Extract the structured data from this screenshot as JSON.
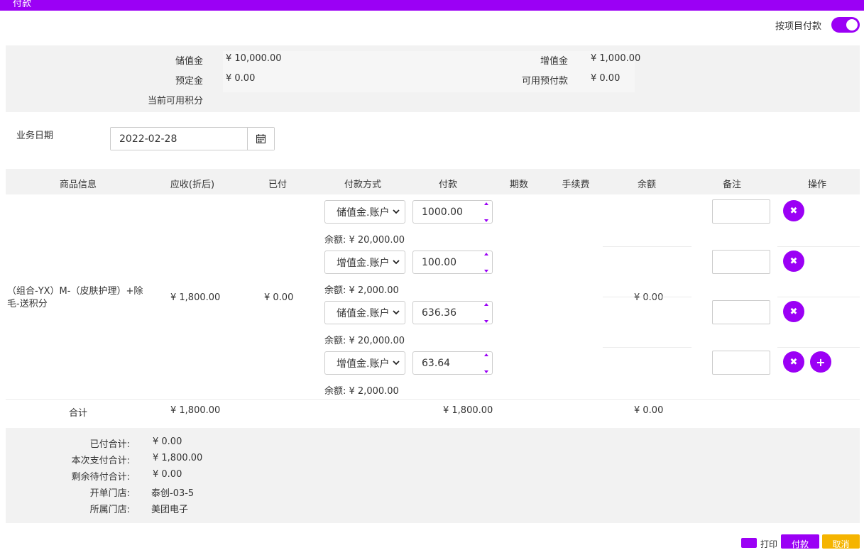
{
  "window": {
    "title": "付款"
  },
  "toggle": {
    "label": "按项目付款",
    "on": true
  },
  "balances": [
    {
      "label": "储值金",
      "value": "¥ 10,000.00"
    },
    {
      "label": "增值金",
      "value": "¥ 1,000.00"
    },
    {
      "label": "预定金",
      "value": "¥ 0.00"
    },
    {
      "label": "可用预付款",
      "value": "¥ 0.00"
    },
    {
      "label": "当前可用积分",
      "value": ""
    }
  ],
  "business_date": {
    "label": "业务日期",
    "value": "2022-02-28"
  },
  "table": {
    "headers": [
      "商品信息",
      "应收(折后)",
      "已付",
      "付款方式",
      "付款",
      "期数",
      "手续费",
      "余额",
      "备注",
      "操作"
    ],
    "row": {
      "product": "（组合-YX）M-（皮肤护理）+除毛-送积分",
      "receivable": "¥ 1,800.00",
      "paid": "¥ 0.00",
      "balance": "¥ 0.00",
      "payments": [
        {
          "method": "储值金.账户",
          "amount": "1000.00",
          "remaining": "余额: ¥ 20,000.00"
        },
        {
          "method": "增值金.账户",
          "amount": "100.00",
          "remaining": "余额: ¥ 2,000.00"
        },
        {
          "method": "储值金.账户",
          "amount": "636.36",
          "remaining": "余额: ¥ 20,000.00"
        },
        {
          "method": "增值金.账户",
          "amount": "63.64",
          "remaining": "余额: ¥ 2,000.00"
        }
      ]
    },
    "total": {
      "label": "合计",
      "receivable": "¥ 1,800.00",
      "payment": "¥ 1,800.00",
      "balance": "¥ 0.00"
    }
  },
  "summary": [
    {
      "label": "已付合计:",
      "value": "¥ 0.00"
    },
    {
      "label": "本次支付合计:",
      "value": "¥ 1,800.00"
    },
    {
      "label": "剩余待付合计:",
      "value": "¥ 0.00"
    },
    {
      "label": "开单门店:",
      "value": "泰创-03-5"
    },
    {
      "label": "所属门店:",
      "value": "美团电子"
    }
  ],
  "footer": {
    "print_label": "打印",
    "pay_label": "付款",
    "cancel_label": "取消"
  },
  "colors": {
    "accent": "#9b00f5",
    "warning": "#f5b400"
  }
}
